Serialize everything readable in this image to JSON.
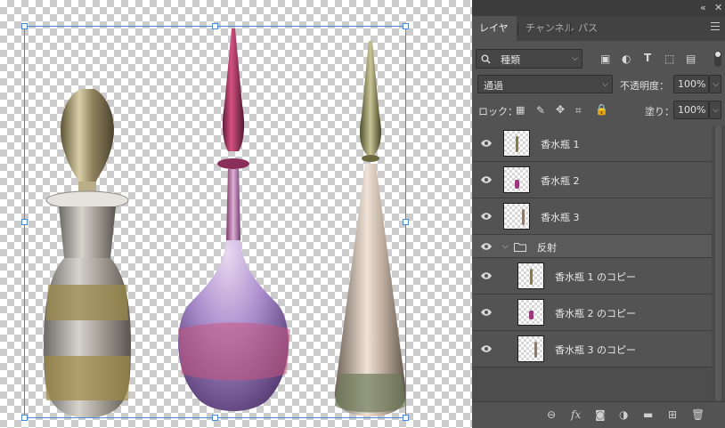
{
  "panel": {
    "collapse_glyph": "«",
    "close_glyph": "✕",
    "tabs": [
      "レイヤー",
      "チャンネル",
      "パス"
    ],
    "active_tab": 0,
    "filter_kind": "種類",
    "blend_mode": "通過",
    "opacity_label": "不透明度：",
    "opacity_value": "100%",
    "lock_label": "ロック：",
    "fill_label": "塗り：",
    "fill_value": "100%"
  },
  "layers": [
    {
      "name": "香水瓶 1",
      "type": "layer",
      "visible": true,
      "color": "#8a7b48"
    },
    {
      "name": "香水瓶 2",
      "type": "layer",
      "visible": true,
      "color": "#9a3a7a"
    },
    {
      "name": "香水瓶 3",
      "type": "layer",
      "visible": true,
      "color": "#8c7c70"
    },
    {
      "name": "反射",
      "type": "group",
      "visible": true,
      "expanded": true
    },
    {
      "name": "香水瓶 1 のコピー",
      "type": "layer",
      "visible": true,
      "color": "#8a7b48"
    },
    {
      "name": "香水瓶 2 のコピー",
      "type": "layer",
      "visible": true,
      "color": "#9a3a7a"
    },
    {
      "name": "香水瓶 3 のコピー",
      "type": "layer",
      "visible": true,
      "color": "#8c7c70"
    }
  ],
  "icons": {
    "search": "search-icon",
    "eye": "eye-icon",
    "folder": "folder-icon",
    "menu": "panel-menu-icon"
  },
  "colors": {
    "panel_bg": "#535353",
    "selection_bbox": "#4a8bd6"
  }
}
